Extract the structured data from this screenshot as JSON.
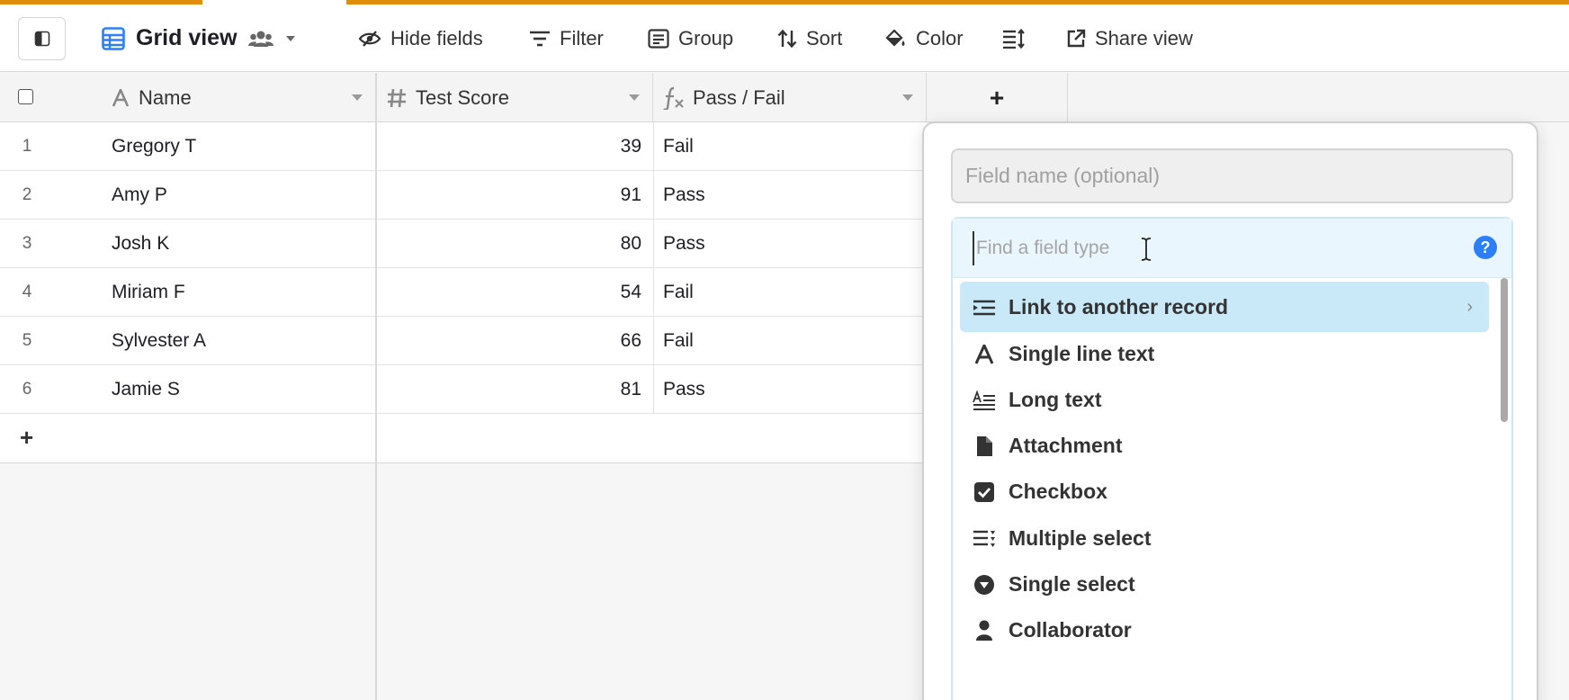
{
  "toolbar": {
    "view_name": "Grid view",
    "hide_fields": "Hide fields",
    "filter": "Filter",
    "group": "Group",
    "sort": "Sort",
    "color": "Color",
    "share_view": "Share view"
  },
  "columns": {
    "name": "Name",
    "test_score": "Test Score",
    "pass_fail": "Pass / Fail",
    "add": "+"
  },
  "rows": [
    {
      "num": "1",
      "name": "Gregory T",
      "score": "39",
      "result": "Fail"
    },
    {
      "num": "2",
      "name": "Amy P",
      "score": "91",
      "result": "Pass"
    },
    {
      "num": "3",
      "name": "Josh K",
      "score": "80",
      "result": "Pass"
    },
    {
      "num": "4",
      "name": "Miriam F",
      "score": "54",
      "result": "Fail"
    },
    {
      "num": "5",
      "name": "Sylvester A",
      "score": "66",
      "result": "Fail"
    },
    {
      "num": "6",
      "name": "Jamie S",
      "score": "81",
      "result": "Pass"
    }
  ],
  "add_row": "+",
  "popover": {
    "field_name_placeholder": "Field name (optional)",
    "search_placeholder": "Find a field type",
    "help": "?",
    "types": [
      {
        "label": "Link to another record",
        "icon": "link-record-icon"
      },
      {
        "label": "Single line text",
        "icon": "single-line-text-icon"
      },
      {
        "label": "Long text",
        "icon": "long-text-icon"
      },
      {
        "label": "Attachment",
        "icon": "attachment-icon"
      },
      {
        "label": "Checkbox",
        "icon": "checkbox-icon"
      },
      {
        "label": "Multiple select",
        "icon": "multiple-select-icon"
      },
      {
        "label": "Single select",
        "icon": "single-select-icon"
      },
      {
        "label": "Collaborator",
        "icon": "collaborator-icon"
      }
    ]
  },
  "colors": {
    "accent": "#e28d0a",
    "view_icon": "#2d7ff9",
    "highlight": "#c9e9f9"
  }
}
